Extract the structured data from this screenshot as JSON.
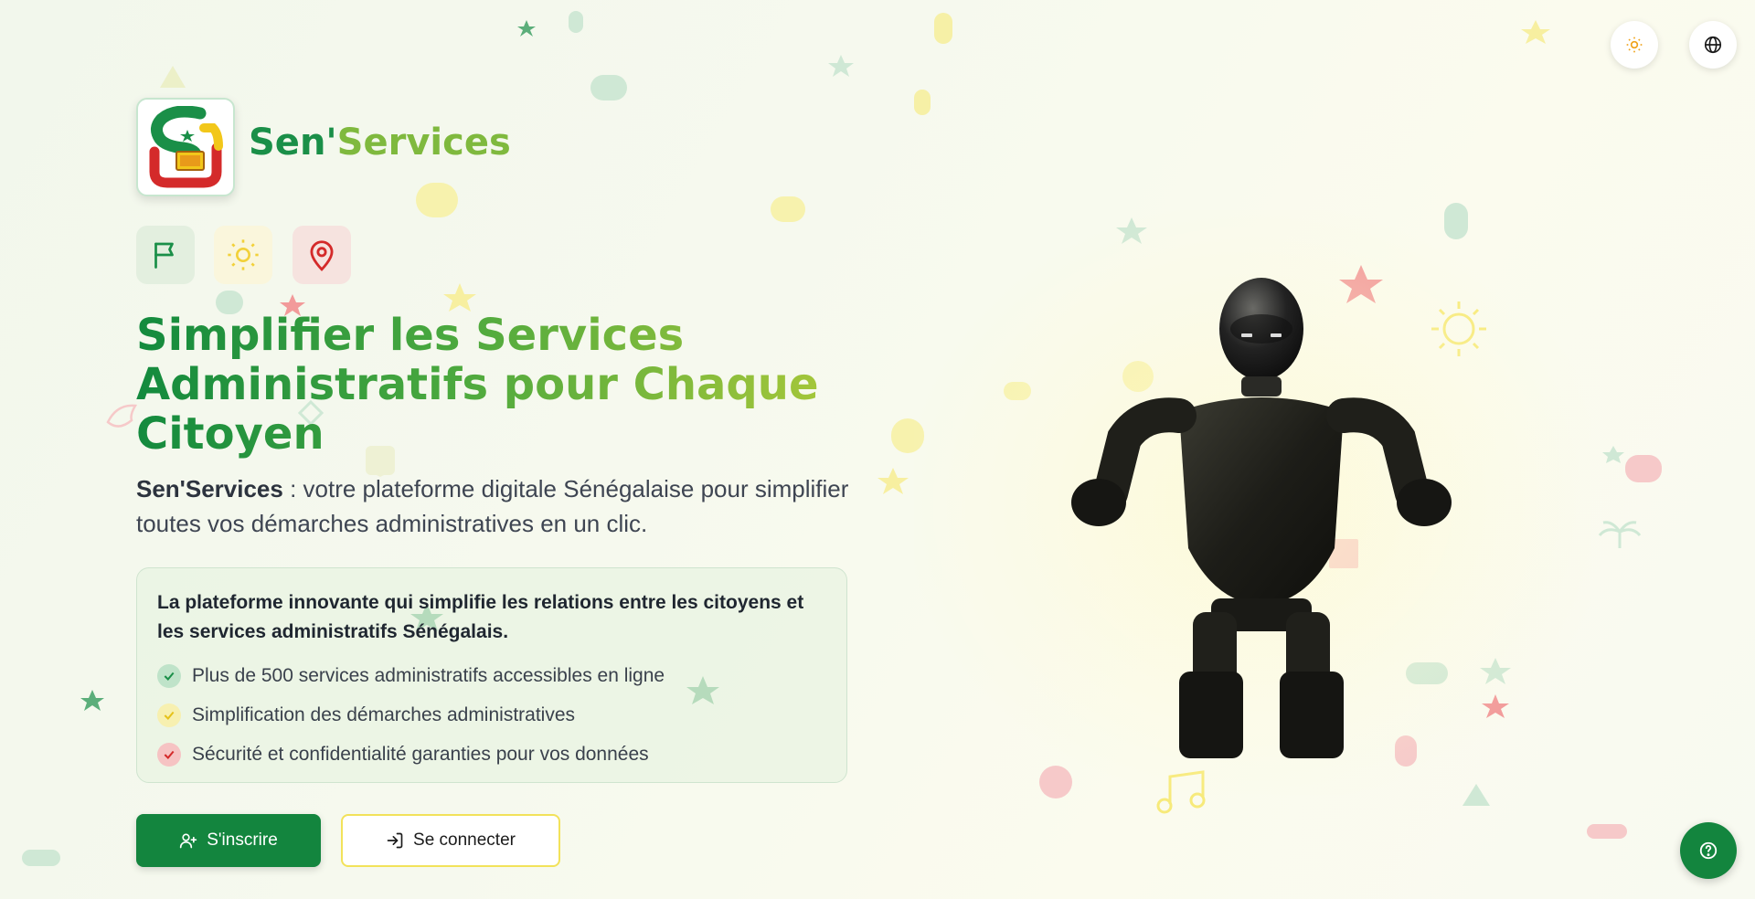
{
  "brand": {
    "name_part1": "Sen'",
    "name_part2": "Services",
    "logo_alt": "Sen'Services logo"
  },
  "header": {
    "theme_toggle_icon": "sun-icon",
    "language_icon": "globe-icon"
  },
  "chips": [
    {
      "icon": "flag-icon",
      "color": "#1a8f48"
    },
    {
      "icon": "sun-icon",
      "color": "#f2d13a"
    },
    {
      "icon": "map-pin-icon",
      "color": "#d42a2a"
    }
  ],
  "hero": {
    "headline": "Simplifier les Services Administratifs pour Chaque Citoyen",
    "lead_brand": "Sen'Services",
    "lead_text": " : votre plateforme digitale Sénégalaise pour simplifier toutes vos démarches administratives en un clic."
  },
  "card": {
    "title": "La plateforme innovante qui simplifie les relations entre les citoyens et les services administratifs Sénégalais.",
    "features": [
      {
        "text": "Plus de 500 services administratifs accessibles en ligne",
        "color": "#1a8f48"
      },
      {
        "text": "Simplification des démarches administratives",
        "color": "#e6c21a"
      },
      {
        "text": "Sécurité et confidentialité garanties pour vos données",
        "color": "#d42a2a"
      }
    ]
  },
  "actions": {
    "signup_label": "S'inscrire",
    "login_label": "Se connecter"
  },
  "help": {
    "icon": "help-circle-icon"
  },
  "colors": {
    "primary_green": "#13853e",
    "accent_yellow": "#f2e25a",
    "accent_red": "#d42a2a"
  }
}
